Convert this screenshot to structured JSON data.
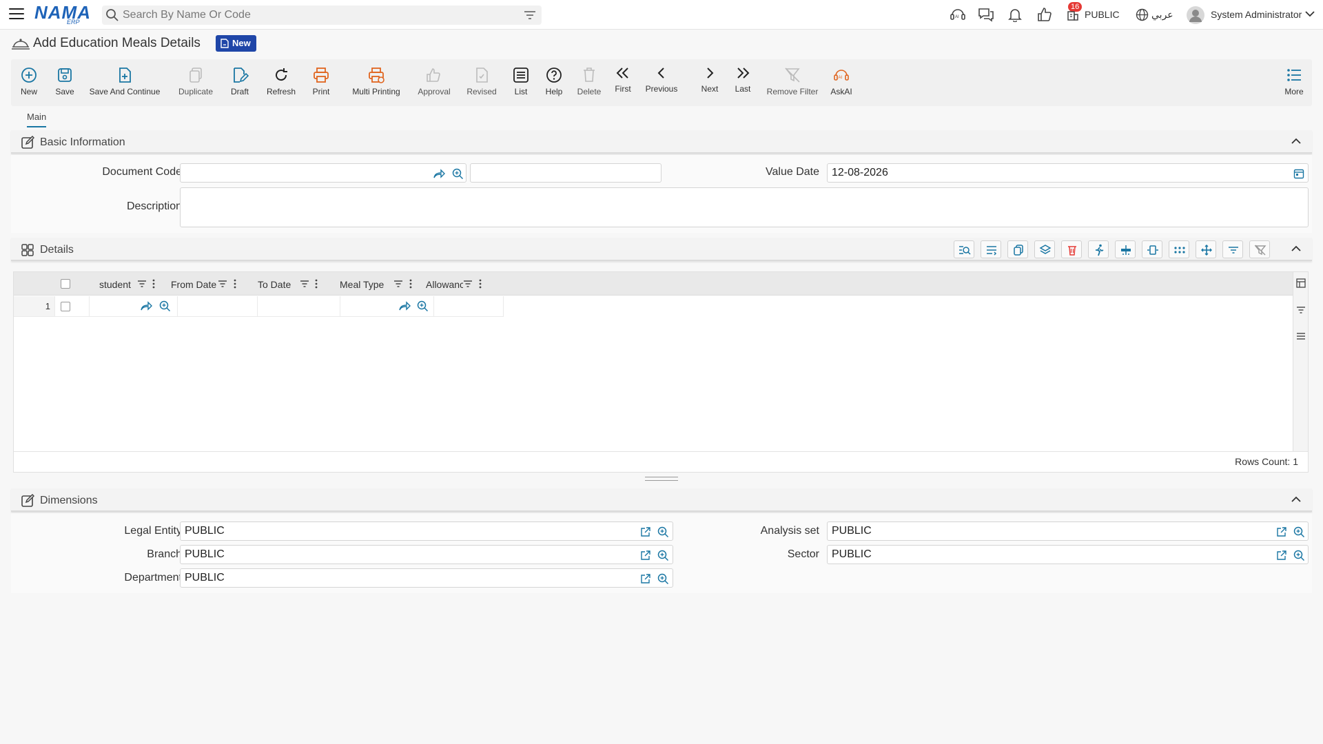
{
  "topbar": {
    "search_placeholder": "Search By Name Or Code",
    "notifications_count": "16",
    "company": "PUBLIC",
    "language": "عربي",
    "user": "System Administrator"
  },
  "logo": {
    "main": "NAMA",
    "sub": "ERP"
  },
  "page": {
    "title": "Add Education Meals Details",
    "badge": "New"
  },
  "toolbar": {
    "new": "New",
    "save": "Save",
    "save_continue": "Save And Continue",
    "duplicate": "Duplicate",
    "draft": "Draft",
    "refresh": "Refresh",
    "print": "Print",
    "multi_printing": "Multi Printing",
    "approval": "Approval",
    "revised": "Revised",
    "list": "List",
    "help": "Help",
    "delete": "Delete",
    "first": "First",
    "previous": "Previous",
    "next": "Next",
    "last": "Last",
    "remove_filter": "Remove Filter",
    "askai": "AskAI",
    "more": "More"
  },
  "tabs": {
    "main": "Main"
  },
  "basic_info": {
    "title": "Basic Information",
    "document_code_label": "Document Code",
    "document_code_value": "",
    "document_code_name": "",
    "value_date_label": "Value Date",
    "value_date": "12-08-2026",
    "description_label": "Description",
    "description": ""
  },
  "details": {
    "title": "Details",
    "columns": [
      "student",
      "From Date",
      "To Date",
      "Meal Type",
      "Allowanc"
    ],
    "rows": [
      {
        "num": "1"
      }
    ],
    "rows_count": "Rows Count: 1"
  },
  "dimensions": {
    "title": "Dimensions",
    "legal_entity_label": "Legal Entity",
    "legal_entity": "PUBLIC",
    "branch_label": "Branch",
    "branch": "PUBLIC",
    "department_label": "Department",
    "department": "PUBLIC",
    "analysis_set_label": "Analysis set",
    "analysis_set": "PUBLIC",
    "sector_label": "Sector",
    "sector": "PUBLIC"
  },
  "colors": {
    "primary": "#1976a3",
    "badge": "#1f46a8",
    "orange": "#e0641e",
    "danger": "#e53935"
  }
}
